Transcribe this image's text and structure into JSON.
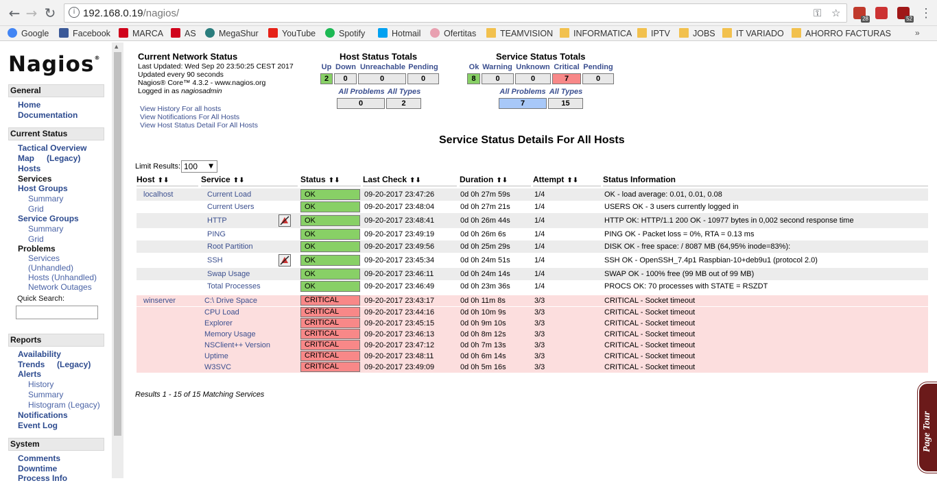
{
  "browser": {
    "url_host": "192.168.0.19",
    "url_path": "/nagios/",
    "extensions": [
      {
        "name": "adblock-icon",
        "badge": "28",
        "color": "#c0392b"
      },
      {
        "name": "youtube-ext-icon",
        "badge": "",
        "color": "#cc3333"
      },
      {
        "name": "ublock-icon",
        "badge": "52",
        "color": "#a01818"
      }
    ]
  },
  "bookmarks": [
    {
      "label": "Google",
      "icon": "google-icon",
      "color": "#4285f4"
    },
    {
      "label": "Facebook",
      "icon": "facebook-icon",
      "color": "#3b5998"
    },
    {
      "label": "MARCA",
      "icon": "marca-icon",
      "color": "#d0021b"
    },
    {
      "label": "AS",
      "icon": "as-icon",
      "color": "#d0021b"
    },
    {
      "label": "MegaShur",
      "icon": "megashur-icon",
      "color": "#2a7d7d"
    },
    {
      "label": "YouTube",
      "icon": "youtube-icon",
      "color": "#e62117"
    },
    {
      "label": "Spotify",
      "icon": "spotify-icon",
      "color": "#1db954"
    },
    {
      "label": "Hotmail",
      "icon": "windows-icon",
      "color": "#00a1f1"
    },
    {
      "label": "Ofertitas",
      "icon": "piggy-icon",
      "color": "#e8a0b0"
    },
    {
      "label": "TEAMVISION",
      "icon": "folder-icon",
      "color": "#f2c14e"
    },
    {
      "label": "INFORMATICA",
      "icon": "folder-icon",
      "color": "#f2c14e"
    },
    {
      "label": "IPTV",
      "icon": "folder-icon",
      "color": "#f2c14e"
    },
    {
      "label": "JOBS",
      "icon": "folder-icon",
      "color": "#f2c14e"
    },
    {
      "label": "IT VARIADO",
      "icon": "folder-icon",
      "color": "#f2c14e"
    },
    {
      "label": "AHORRO FACTURAS",
      "icon": "folder-icon",
      "color": "#f2c14e"
    }
  ],
  "sidebar": {
    "logo": "Nagios",
    "logo_reg": "®",
    "general_head": "General",
    "home": "Home",
    "documentation": "Documentation",
    "current_status_head": "Current Status",
    "tactical_overview": "Tactical Overview",
    "map": "Map",
    "map_legacy": "(Legacy)",
    "hosts": "Hosts",
    "services": "Services",
    "host_groups": "Host Groups",
    "hg_summary": "Summary",
    "hg_grid": "Grid",
    "service_groups": "Service Groups",
    "sg_summary": "Summary",
    "sg_grid": "Grid",
    "problems": "Problems",
    "pr_services": "Services",
    "pr_unhandled": "(Unhandled)",
    "pr_hosts_unhandled": "Hosts (Unhandled)",
    "pr_network_outages": "Network Outages",
    "quick_search": "Quick Search:",
    "reports_head": "Reports",
    "availability": "Availability",
    "trends": "Trends",
    "trends_legacy": "(Legacy)",
    "alerts": "Alerts",
    "al_history": "History",
    "al_summary": "Summary",
    "al_histogram": "Histogram (Legacy)",
    "notifications": "Notifications",
    "event_log": "Event Log",
    "system_head": "System",
    "comments": "Comments",
    "downtime": "Downtime",
    "process_info": "Process Info"
  },
  "status": {
    "title": "Current Network Status",
    "last_updated": "Last Updated: Wed Sep 20 23:50:25 CEST 2017",
    "update_interval": "Updated every 90 seconds",
    "version": "Nagios® Core™ 4.3.2 - www.nagios.org",
    "logged_prefix": "Logged in as ",
    "logged_user": "nagiosadmin",
    "view_history": "View History For all hosts",
    "view_notifications": "View Notifications For All Hosts",
    "view_host_detail": "View Host Status Detail For All Hosts"
  },
  "host_totals": {
    "title": "Host Status Totals",
    "headers": [
      "Up",
      "Down",
      "Unreachable",
      "Pending"
    ],
    "values": [
      "2",
      "0",
      "0",
      "0"
    ],
    "all_problems": "All Problems",
    "all_types": "All Types",
    "all_problems_value": "0",
    "all_types_value": "2"
  },
  "service_totals": {
    "title": "Service Status Totals",
    "headers": [
      "Ok",
      "Warning",
      "Unknown",
      "Critical",
      "Pending"
    ],
    "values": [
      "8",
      "0",
      "0",
      "7",
      "0"
    ],
    "all_problems": "All Problems",
    "all_types": "All Types",
    "all_problems_value": "7",
    "all_types_value": "15"
  },
  "details": {
    "title": "Service Status Details For All Hosts",
    "limit_label": "Limit Results:",
    "limit_value": "100",
    "columns": [
      "Host",
      "Service",
      "Status",
      "Last Check",
      "Duration",
      "Attempt",
      "Status Information"
    ],
    "sort_glyph": "⬆⬇",
    "results": "Results 1 - 15 of 15 Matching Services"
  },
  "rows": [
    {
      "host": "localhost",
      "service": "Current Load",
      "status": "OK",
      "last_check": "09-20-2017 23:47:26",
      "duration": "0d 0h 27m 59s",
      "attempt": "1/4",
      "info": "OK - load average: 0.01, 0.01, 0.08",
      "notif": false
    },
    {
      "host": "",
      "service": "Current Users",
      "status": "OK",
      "last_check": "09-20-2017 23:48:04",
      "duration": "0d 0h 27m 21s",
      "attempt": "1/4",
      "info": "USERS OK - 3 users currently logged in",
      "notif": false
    },
    {
      "host": "",
      "service": "HTTP",
      "status": "OK",
      "last_check": "09-20-2017 23:48:41",
      "duration": "0d 0h 26m 44s",
      "attempt": "1/4",
      "info": "HTTP OK: HTTP/1.1 200 OK - 10977 bytes in 0,002 second response time",
      "notif": true
    },
    {
      "host": "",
      "service": "PING",
      "status": "OK",
      "last_check": "09-20-2017 23:49:19",
      "duration": "0d 0h 26m 6s",
      "attempt": "1/4",
      "info": "PING OK - Packet loss = 0%, RTA = 0.13 ms",
      "notif": false
    },
    {
      "host": "",
      "service": "Root Partition",
      "status": "OK",
      "last_check": "09-20-2017 23:49:56",
      "duration": "0d 0h 25m 29s",
      "attempt": "1/4",
      "info": "DISK OK - free space: / 8087 MB (64,95% inode=83%):",
      "notif": false
    },
    {
      "host": "",
      "service": "SSH",
      "status": "OK",
      "last_check": "09-20-2017 23:45:34",
      "duration": "0d 0h 24m 51s",
      "attempt": "1/4",
      "info": "SSH OK - OpenSSH_7.4p1 Raspbian-10+deb9u1 (protocol 2.0)",
      "notif": true
    },
    {
      "host": "",
      "service": "Swap Usage",
      "status": "OK",
      "last_check": "09-20-2017 23:46:11",
      "duration": "0d 0h 24m 14s",
      "attempt": "1/4",
      "info": "SWAP OK - 100% free (99 MB out of 99 MB)",
      "notif": false
    },
    {
      "host": "",
      "service": "Total Processes",
      "status": "OK",
      "last_check": "09-20-2017 23:46:49",
      "duration": "0d 0h 23m 36s",
      "attempt": "1/4",
      "info": "PROCS OK: 70 processes with STATE = RSZDT",
      "notif": false
    },
    {
      "host": "winserver",
      "service": "C:\\ Drive Space",
      "status": "CRITICAL",
      "last_check": "09-20-2017 23:43:17",
      "duration": "0d 0h 11m 8s",
      "attempt": "3/3",
      "info": "CRITICAL - Socket timeout",
      "notif": false
    },
    {
      "host": "",
      "service": "CPU Load",
      "status": "CRITICAL",
      "last_check": "09-20-2017 23:44:16",
      "duration": "0d 0h 10m 9s",
      "attempt": "3/3",
      "info": "CRITICAL - Socket timeout",
      "notif": false
    },
    {
      "host": "",
      "service": "Explorer",
      "status": "CRITICAL",
      "last_check": "09-20-2017 23:45:15",
      "duration": "0d 0h 9m 10s",
      "attempt": "3/3",
      "info": "CRITICAL - Socket timeout",
      "notif": false
    },
    {
      "host": "",
      "service": "Memory Usage",
      "status": "CRITICAL",
      "last_check": "09-20-2017 23:46:13",
      "duration": "0d 0h 8m 12s",
      "attempt": "3/3",
      "info": "CRITICAL - Socket timeout",
      "notif": false
    },
    {
      "host": "",
      "service": "NSClient++ Version",
      "status": "CRITICAL",
      "last_check": "09-20-2017 23:47:12",
      "duration": "0d 0h 7m 13s",
      "attempt": "3/3",
      "info": "CRITICAL - Socket timeout",
      "notif": false
    },
    {
      "host": "",
      "service": "Uptime",
      "status": "CRITICAL",
      "last_check": "09-20-2017 23:48:11",
      "duration": "0d 0h 6m 14s",
      "attempt": "3/3",
      "info": "CRITICAL - Socket timeout",
      "notif": false
    },
    {
      "host": "",
      "service": "W3SVC",
      "status": "CRITICAL",
      "last_check": "09-20-2017 23:49:09",
      "duration": "0d 0h 5m 16s",
      "attempt": "3/3",
      "info": "CRITICAL - Socket timeout",
      "notif": false
    }
  ],
  "colors": {
    "ok": "#88d066",
    "critical": "#f88888",
    "row_even": "#ffffff",
    "row_odd": "#ececec",
    "row_crit": "#fcdede",
    "link": "#3b4f8f",
    "all_problems_highlight": "#a8c8f8"
  },
  "page_tour": "Page Tour"
}
